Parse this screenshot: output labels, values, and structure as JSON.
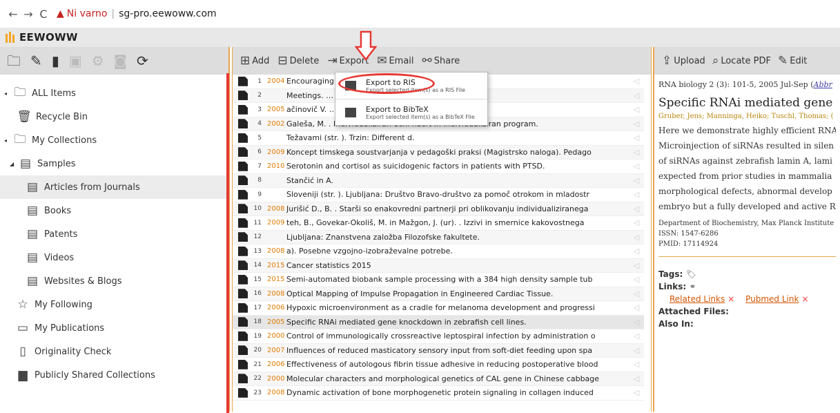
{
  "browser": {
    "back": "←",
    "forward": "→",
    "reload": "C",
    "security_text": "Ni varno",
    "url": "sg-pro.eewoww.com"
  },
  "app": {
    "logo_text": "EEWOWW"
  },
  "left_panel": {
    "tree": [
      {
        "label": "ALL Items",
        "icon": "folder-icon",
        "arrow": true
      },
      {
        "label": "Recycle Bin",
        "icon": "trash-icon",
        "arrow": false
      },
      {
        "label": "My Collections",
        "icon": "folder-icon",
        "arrow": true
      },
      {
        "label": "Samples",
        "icon": "list-icon",
        "arrow": true
      },
      {
        "label": "Articles from Journals",
        "icon": "list-icon",
        "arrow": false,
        "selected": true
      },
      {
        "label": "Books",
        "icon": "list-icon",
        "arrow": false
      },
      {
        "label": "Patents",
        "icon": "list-icon",
        "arrow": false
      },
      {
        "label": "Videos",
        "icon": "list-icon",
        "arrow": false
      },
      {
        "label": "Websites & Blogs",
        "icon": "list-icon",
        "arrow": false
      },
      {
        "label": "My Following",
        "icon": "star-icon",
        "arrow": false
      },
      {
        "label": "My Publications",
        "icon": "publications-icon",
        "arrow": false
      },
      {
        "label": "Originality Check",
        "icon": "check-icon",
        "arrow": false
      },
      {
        "label": "Publicly Shared Collections",
        "icon": "shared-icon",
        "arrow": false
      }
    ]
  },
  "toolbar": {
    "add": "Add",
    "delete": "Delete",
    "export": "Export",
    "email": "Email",
    "share": "Share"
  },
  "export_menu": [
    {
      "title": "Export to RIS",
      "subtitle": "Export selected item(s) as a RIS File"
    },
    {
      "title": "Export to BibTeX",
      "subtitle": "Export selected item(s) as a BibTeX File"
    }
  ],
  "articles": [
    {
      "num": "1",
      "year": "2004",
      "title": "Encouraging … eam"
    },
    {
      "num": "2",
      "year": "",
      "title": "Meetings. … objljeno s http://www.casenex.co"
    },
    {
      "num": "3",
      "year": "2005",
      "title": "ačinovič V. … a odnosa in osebnega stika."
    },
    {
      "num": "4",
      "year": "2002",
      "title": "Galeša, M. . Individualiziran učni načrt in individualiziran program."
    },
    {
      "num": "5",
      "year": "",
      "title": "Težavami (str. ). Trzin: Different d."
    },
    {
      "num": "6",
      "year": "2009",
      "title": "Koncept timskega soustvarjanja v pedagoški praksi (Magistrsko naloga). Pedago"
    },
    {
      "num": "7",
      "year": "2010",
      "title": "Serotonin and cortisol as suicidogenic factors in patients with PTSD."
    },
    {
      "num": "8",
      "year": "",
      "title": "Stančić in A."
    },
    {
      "num": "9",
      "year": "",
      "title": "Sloveniji (str. ). Ljubljana: Društvo Bravo-društvo za pomoč otrokom in mladostr"
    },
    {
      "num": "10",
      "year": "2008",
      "title": "Jurišić D., B. . Starši so enakovredni partnerji pri oblikovanju individualiziranega"
    },
    {
      "num": "11",
      "year": "2009",
      "title": "teh, B., Govekar-Okoliš, M. in Mažgon, J. (ur). . Izzivi in smernice kakovostnega"
    },
    {
      "num": "12",
      "year": "",
      "title": "Ljubljana: Znanstvena založba Filozofske fakultete."
    },
    {
      "num": "13",
      "year": "2008",
      "title": "a). Posebne vzgojno-izobraževalne potrebe."
    },
    {
      "num": "14",
      "year": "2015",
      "title": "Cancer statistics 2015"
    },
    {
      "num": "15",
      "year": "2015",
      "title": "Semi-automated biobank sample processing with a 384 high density sample tub"
    },
    {
      "num": "16",
      "year": "2008",
      "title": "Optical Mapping of Impulse Propagation in Engineered Cardiac Tissue."
    },
    {
      "num": "17",
      "year": "2006",
      "title": "Hypoxic microenvironment as a cradle for melanoma development and progressi"
    },
    {
      "num": "18",
      "year": "2005",
      "title": "Specific RNAi mediated gene knockdown in zebrafish cell lines."
    },
    {
      "num": "19",
      "year": "2000",
      "title": "Control of immunologically crossreactive leptospiral infection by administration o"
    },
    {
      "num": "20",
      "year": "2007",
      "title": "Influences of reduced masticatory sensory input from soft-diet feeding upon spa"
    },
    {
      "num": "21",
      "year": "2006",
      "title": "Effectiveness of autologous fibrin tissue adhesive in reducing postoperative blood"
    },
    {
      "num": "22",
      "year": "2000",
      "title": "Molecular characters and morphological genetics of CAL gene in Chinese cabbage"
    },
    {
      "num": "23",
      "year": "2008",
      "title": "Dynamic activation of bone morphogenetic protein signaling in collagen induced"
    }
  ],
  "right_toolbar": {
    "upload": "Upload",
    "locate_pdf": "Locate PDF",
    "edit": "Edit"
  },
  "detail": {
    "journal": "RNA biology 2 (3): 101-5, 2005 Jul-Sep (",
    "journal_abbr": "Abbr",
    "title": "Specific RNAi mediated gene",
    "authors": "Gruber, Jens; Manninga, Heiko; Tuschl, Thomas; (",
    "abstract_lines": [
      "Here we demonstrate highly efficient RNA",
      "Microinjection of siRNAs resulted in silen",
      "of siRNAs against zebrafish lamin A, lami",
      "expected from prior studies in mammalia",
      "morphological defects, abnormal develop",
      "embryo but a fully developed and active R"
    ],
    "department": "Department of Biochemistry, Max Planck Institute",
    "issn": "ISSN: 1547-6286",
    "pmid": "PMID: 17114924",
    "tags_label": "Tags:",
    "links_label": "Links:",
    "link1": "Related Links",
    "link2": "Pubmed Link",
    "remove_mark": "×",
    "attached_label": "Attached Files:",
    "also_label": "Also In:"
  }
}
